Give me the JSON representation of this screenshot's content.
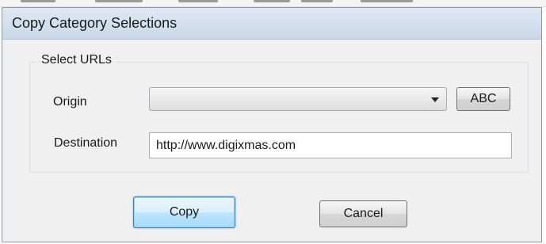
{
  "dialog": {
    "title": "Copy Category Selections"
  },
  "group": {
    "label": "Select URLs",
    "origin_label": "Origin",
    "origin_selected": "",
    "abc_button": "ABC",
    "destination_label": "Destination",
    "destination_value": "http://www.digixmas.com"
  },
  "buttons": {
    "copy": "Copy",
    "cancel": "Cancel"
  },
  "icons": {
    "dropdown": "chevron-down-icon"
  }
}
